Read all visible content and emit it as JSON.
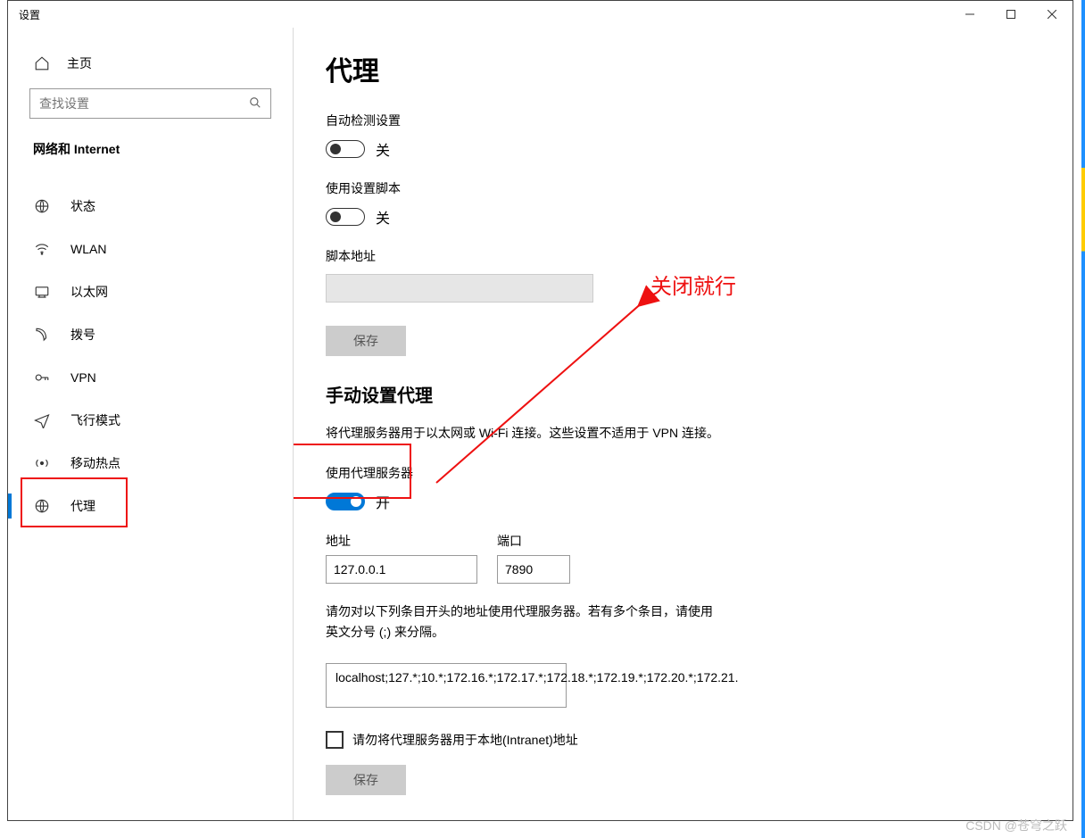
{
  "window": {
    "title": "设置"
  },
  "sidebar": {
    "home": "主页",
    "search_placeholder": "查找设置",
    "section": "网络和 Internet",
    "items": [
      {
        "icon": "status-icon",
        "label": "状态"
      },
      {
        "icon": "wifi-icon",
        "label": "WLAN"
      },
      {
        "icon": "ethernet-icon",
        "label": "以太网"
      },
      {
        "icon": "dialup-icon",
        "label": "拨号"
      },
      {
        "icon": "vpn-icon",
        "label": "VPN"
      },
      {
        "icon": "airplane-icon",
        "label": "飞行模式"
      },
      {
        "icon": "hotspot-icon",
        "label": "移动热点"
      },
      {
        "icon": "proxy-icon",
        "label": "代理",
        "active": true
      }
    ]
  },
  "main": {
    "title": "代理",
    "auto_detect_label": "自动检测设置",
    "auto_detect_state": "关",
    "use_script_label": "使用设置脚本",
    "use_script_state": "关",
    "script_addr_label": "脚本地址",
    "script_addr_value": "",
    "save1": "保存",
    "manual_section": "手动设置代理",
    "manual_desc": "将代理服务器用于以太网或 Wi-Fi 连接。这些设置不适用于 VPN 连接。",
    "use_proxy_label": "使用代理服务器",
    "use_proxy_state": "开",
    "addr_label": "地址",
    "addr_value": "127.0.0.1",
    "port_label": "端口",
    "port_value": "7890",
    "bypass_desc": "请勿对以下列条目开头的地址使用代理服务器。若有多个条目，请使用英文分号 (;) 来分隔。",
    "bypass_value": "localhost;127.*;10.*;172.16.*;172.17.*;172.18.*;172.19.*;172.20.*;172.21.",
    "intranet_label": "请勿将代理服务器用于本地(Intranet)地址",
    "save2": "保存"
  },
  "annotation": {
    "text": "关闭就行"
  },
  "watermark": "CSDN @苍穹之跃"
}
